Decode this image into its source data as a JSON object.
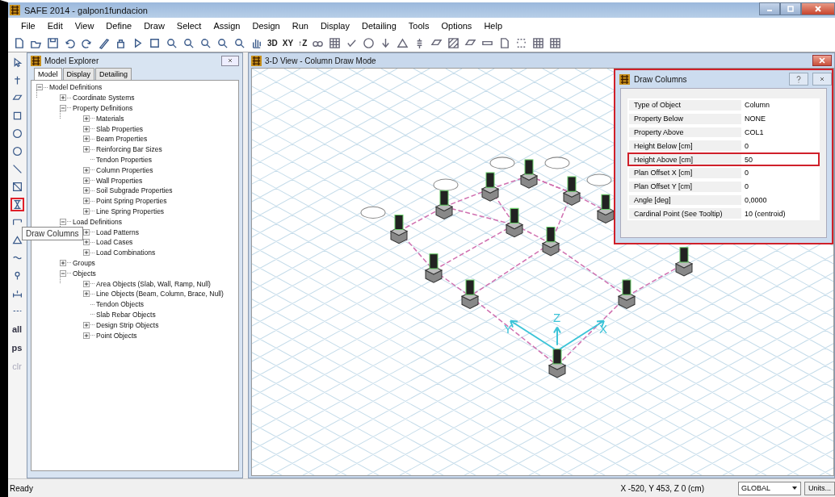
{
  "window": {
    "title": "SAFE 2014 - galpon1fundacion"
  },
  "menu": [
    "File",
    "Edit",
    "View",
    "Define",
    "Draw",
    "Select",
    "Assign",
    "Design",
    "Run",
    "Display",
    "Detailing",
    "Tools",
    "Options",
    "Help"
  ],
  "toolbar": {
    "text_buttons": [
      "3D",
      "XY",
      "↑Z"
    ]
  },
  "left_toolbar": {
    "tools": [
      {
        "selected": false
      },
      {
        "selected": false
      },
      {
        "selected": false
      },
      {
        "selected": false
      },
      {
        "selected": false
      },
      {
        "selected": false
      },
      {
        "selected": false
      },
      {
        "selected": false
      },
      {
        "selected": true
      },
      {
        "selected": false
      },
      {
        "selected": false
      },
      {
        "selected": false
      },
      {
        "selected": false
      },
      {
        "selected": false
      },
      {
        "selected": false
      }
    ],
    "text_buttons": [
      {
        "label": "all",
        "disabled": false
      },
      {
        "label": "ps",
        "disabled": false
      },
      {
        "label": "clr",
        "disabled": true
      }
    ]
  },
  "tooltip": "Draw Columns",
  "model_explorer": {
    "title": "Model Explorer",
    "tabs": [
      {
        "label": "Model",
        "selected": true
      },
      {
        "label": "Display",
        "selected": false
      },
      {
        "label": "Detailing",
        "selected": false
      }
    ],
    "tree": [
      {
        "label": "Model Definitions",
        "kind": "node",
        "expanded": true,
        "children": [
          {
            "label": "Coordinate Systems",
            "kind": "node",
            "expanded": false
          },
          {
            "label": "Property Definitions",
            "kind": "node",
            "expanded": true,
            "children": [
              {
                "label": "Materials",
                "kind": "node",
                "expanded": false
              },
              {
                "label": "Slab Properties",
                "kind": "node",
                "expanded": false
              },
              {
                "label": "Beam Properties",
                "kind": "node",
                "expanded": false
              },
              {
                "label": "Reinforcing Bar Sizes",
                "kind": "node",
                "expanded": false
              },
              {
                "label": "Tendon Properties",
                "kind": "leaf"
              },
              {
                "label": "Column Properties",
                "kind": "node",
                "expanded": false
              },
              {
                "label": "Wall Properties",
                "kind": "node",
                "expanded": false
              },
              {
                "label": "Soil Subgrade Properties",
                "kind": "node",
                "expanded": false
              },
              {
                "label": "Point Spring Properties",
                "kind": "node",
                "expanded": false
              },
              {
                "label": "Line Spring Properties",
                "kind": "node",
                "expanded": false
              }
            ]
          },
          {
            "label": "Load Definitions",
            "kind": "node",
            "expanded": true,
            "children": [
              {
                "label": "Load Patterns",
                "kind": "node",
                "expanded": false
              },
              {
                "label": "Load Cases",
                "kind": "node",
                "expanded": false
              },
              {
                "label": "Load Combinations",
                "kind": "node",
                "expanded": false
              }
            ]
          },
          {
            "label": "Groups",
            "kind": "node",
            "expanded": false
          },
          {
            "label": "Objects",
            "kind": "node",
            "expanded": true,
            "children": [
              {
                "label": "Area Objects (Slab, Wall, Ramp, Null)",
                "kind": "node",
                "expanded": false
              },
              {
                "label": "Line Objects (Beam, Column, Brace, Null)",
                "kind": "node",
                "expanded": false
              },
              {
                "label": "Tendon Objects",
                "kind": "leaf"
              },
              {
                "label": "Slab Rebar Objects",
                "kind": "leaf"
              },
              {
                "label": "Design Strip Objects",
                "kind": "node",
                "expanded": false
              },
              {
                "label": "Point Objects",
                "kind": "node",
                "expanded": false
              }
            ]
          }
        ]
      }
    ]
  },
  "view": {
    "title": "3-D View - Column Draw Mode",
    "axes": [
      "X",
      "Y",
      "Z"
    ]
  },
  "dialog": {
    "title": "Draw Columns",
    "rows": [
      {
        "label": "Type of Object",
        "value": "Column",
        "selected": false
      },
      {
        "label": "Property Below",
        "value": "NONE",
        "selected": false
      },
      {
        "label": "Property Above",
        "value": "COL1",
        "selected": false
      },
      {
        "label": "Height Below  [cm]",
        "value": "0",
        "selected": false
      },
      {
        "label": "Height Above  [cm]",
        "value": "50",
        "selected": true
      },
      {
        "label": "Plan Offset X  [cm]",
        "value": "0",
        "selected": false
      },
      {
        "label": "Plan Offset Y  [cm]",
        "value": "0",
        "selected": false
      },
      {
        "label": "Angle  [deg]",
        "value": "0,0000",
        "selected": false
      },
      {
        "label": "Cardinal Point  (See Tooltip)",
        "value": "10  (centroid)",
        "selected": false
      }
    ]
  },
  "status_bar": {
    "status": "Ready",
    "coordinates": "X -520,  Y 453,  Z 0  (cm)",
    "coordinate_system": "GLOBAL",
    "units_button": "Units..."
  }
}
